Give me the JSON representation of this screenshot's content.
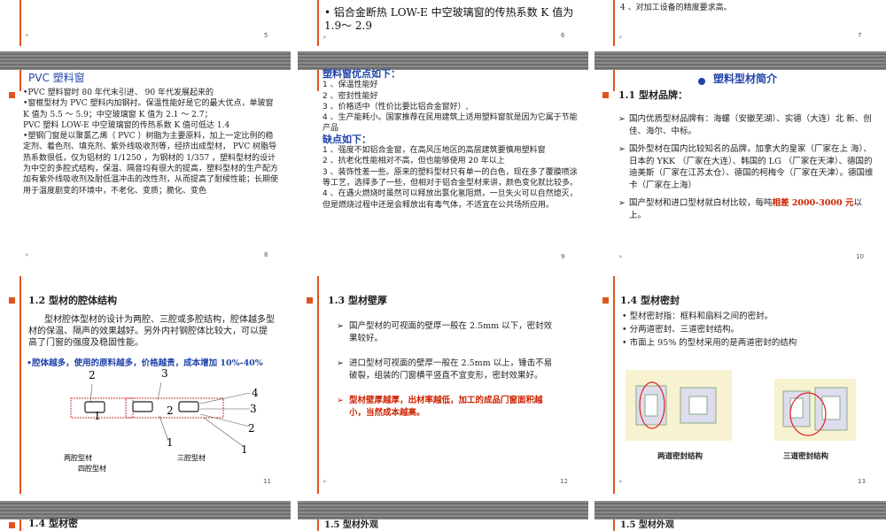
{
  "slides": {
    "s5": {
      "page": "5"
    },
    "s6": {
      "page": "6",
      "bullet": "铝合金断热 LOW-E 中空玻璃窗的传热系数 K 值为 1.9～ 2.9"
    },
    "s7": {
      "page": "7",
      "item4": "4 、对加工设备的精度要求高。"
    },
    "s8": {
      "page": "8",
      "title": "PVC 塑料窗",
      "p1": "PVC 塑料窗时 80 年代末引进、 90 年代发展起来的",
      "p2": "窗框型材为 PVC 塑料内加钢衬。保温性能好是它的最大优点，单玻窗 K 值为 5.5 ～ 5.9；中空玻璃窗 K 值为 2.1 ～ 2.7；",
      "p2b": "PVC 塑料 LOW-E 中空玻璃窗的传热系数 K 值可低达 1.4",
      "p3": "塑钢门窗是以聚氯乙烯（ PVC ）树脂为主要原料，加上一定比例的稳定剂、着色剂、填充剂、紫外线吸收剂等，经挤出成型材， PVC 树脂导热系数很低，仅为铝材的 1/1250 ，为钢材的 1/357 ，塑料型材的设计为中空的多腔式结构，保温、隔音均有很大的提高，塑料型材的生产配方加有紫外线吸收剂及耐低温冲击的改性剂，从而提高了耐候性能；长期使用于温度剧变的环境中，不老化、变质；脆化、变色"
    },
    "s9": {
      "page": "9",
      "adv_title": "塑料窗优点如下：",
      "adv": [
        "1 、保温性能好",
        "2 、密封性能好",
        "3 、价格适中（性价比要比铝合金窗好）,",
        "4 、生产能耗小。国家推荐在民用建筑上适用塑料窗就是因为它属于节能产品"
      ],
      "dis_title": "缺点如下：",
      "dis": [
        "1 、强度不如铝合金窗，在高风压地区的高层建筑要慎用塑料窗",
        "2 、抗老化性能相对不高，但也能够使用 20 年以上",
        "3 、装饰性差一些。原来的塑料型材只有单一的白色，现在多了覆膜喷涂等工艺，选择多了一些，但相对于铝合金型材来讲，颜色变化就比较多。",
        "4 、在遇火燃烧时虽然可以释放出氯化氢阻燃，一旦失火可以自然熄灭，但是燃烧过程中还是会释放出有毒气体，不适宜在公共场所应用。"
      ]
    },
    "s10": {
      "page": "10",
      "main_title": "塑料型材简介",
      "sub": "1.1  型材品牌：",
      "b1": "国内优质型材品牌有：海螺（安徽芜湖）、实德（大连）北 新、创佳、海尔、中标。",
      "b2": "国外型材在国内比较知名的品牌，加拿大的皇家（厂家在上        海）、日本的 YKK （厂家在大连）、韩国的 LG （厂家在天津）、德国的迪美斯（厂家在江苏太仓）、德国的柯梅令（厂家在天津）。德国维卡（厂家在上海）",
      "b3a": "国产型材和进口型材就白材比较，每吨",
      "b3b": "相差 2000-3000 元",
      "b3c": "以上。"
    },
    "s11": {
      "page": "11",
      "title": "1.2  型材的腔体结构",
      "p1": "型材腔体型材的设计为两腔、三腔或多腔结构，腔体越多型材的保温、隔声的效果越好。另外内衬钢腔体比较大，可以提高了门窗的强度及稳固性能。",
      "p2": "•腔体越多，使用的原料越多，价格越贵，成本增加 10%-40%",
      "fig_labels": {
        "n2a": "2",
        "n3a": "3",
        "n4": "4",
        "n1a": "1",
        "n2b": "2",
        "n3b": "3",
        "n2c": "2",
        "n1b": "1",
        "n1c": "1"
      },
      "cap1": "两腔型材",
      "cap2": "三腔型材",
      "cap3": "四腔型材"
    },
    "s12": {
      "page": "12",
      "title": "1.3  型材壁厚",
      "b1": "国产型材的可视面的壁厚一般在 2.5mm 以下，密封效果较好。",
      "b2": "进口型材可视面的壁厚一般在 2.5mm 以上，锤击不易破裂，组装的门窗横平竖直不宜变形，密封效果好。",
      "b3": "型材壁厚越厚，出材率越低，加工的成品门窗面积越小，当然成本越高。"
    },
    "s13": {
      "page": "13",
      "title": "1.4  型材密封",
      "b1": "型材密封指：框料和扇料之间的密封。",
      "b2": "分两道密封、三道密封结构。",
      "b3": "市面上 95% 的型材采用的是两道密封的结构",
      "cap1": "两道密封结构",
      "cap2": "三道密封结构"
    },
    "s14": {
      "title": "1.4  型材密"
    },
    "s15": {
      "title": "1.5  型材外观"
    },
    "s16": {
      "title": "1.5  型材外观"
    }
  },
  "colors": {
    "accent": "#e0541d",
    "blue": "#2244aa",
    "red": "#cc2200",
    "header": "#7a7a7a"
  }
}
